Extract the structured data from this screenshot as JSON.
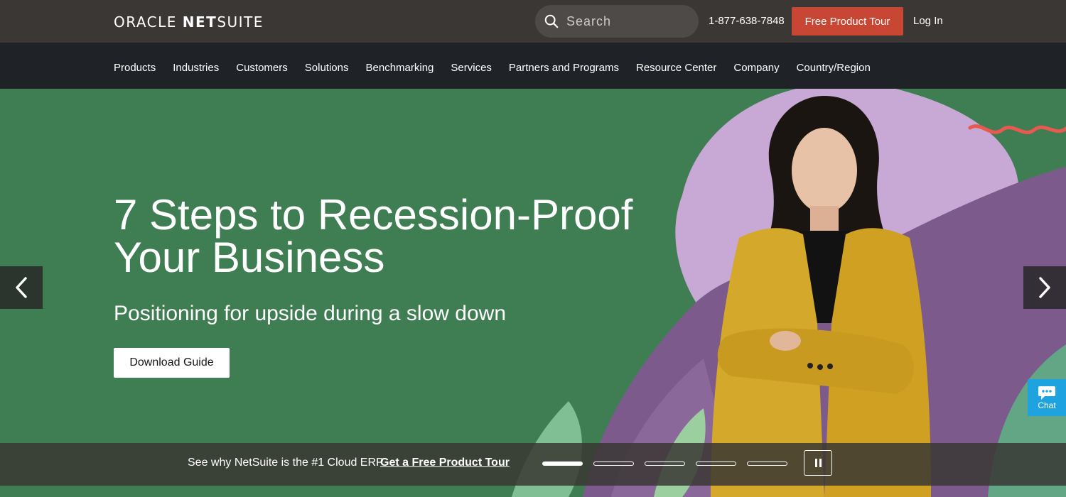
{
  "header": {
    "logo_oracle": "ORACLE",
    "logo_netsuite_bold": "NET",
    "logo_netsuite_rest": "SUITE",
    "search_placeholder": "Search",
    "phone": "1-877-638-7848",
    "tour_button": "Free Product Tour",
    "login": "Log In"
  },
  "nav": {
    "items": [
      "Products",
      "Industries",
      "Customers",
      "Solutions",
      "Benchmarking",
      "Services",
      "Partners and Programs",
      "Resource Center",
      "Company",
      "Country/Region"
    ]
  },
  "hero": {
    "title_line1": "7 Steps to Recession-Proof",
    "title_line2": "Your Business",
    "subtitle": "Positioning for upside during a slow down",
    "cta": "Download Guide",
    "prev_icon": "chevron-left-icon",
    "next_icon": "chevron-right-icon"
  },
  "chat": {
    "label": "Chat",
    "icon": "chat-bubble-icon"
  },
  "strip": {
    "text": "See why NetSuite is the #1 Cloud ERP",
    "link": "Get a Free Product Tour",
    "slide_count": 5,
    "active_slide": 1,
    "pause_icon": "pause-icon"
  },
  "colors": {
    "topbar": "#3a3734",
    "navbar": "#1f2227",
    "hero_green": "#3f7d53",
    "accent_red": "#c74634",
    "chat_blue": "#1fa3e0",
    "blazer_yellow": "#d4a82a",
    "lavender": "#c8a9d6",
    "purple": "#7c5b8c"
  }
}
